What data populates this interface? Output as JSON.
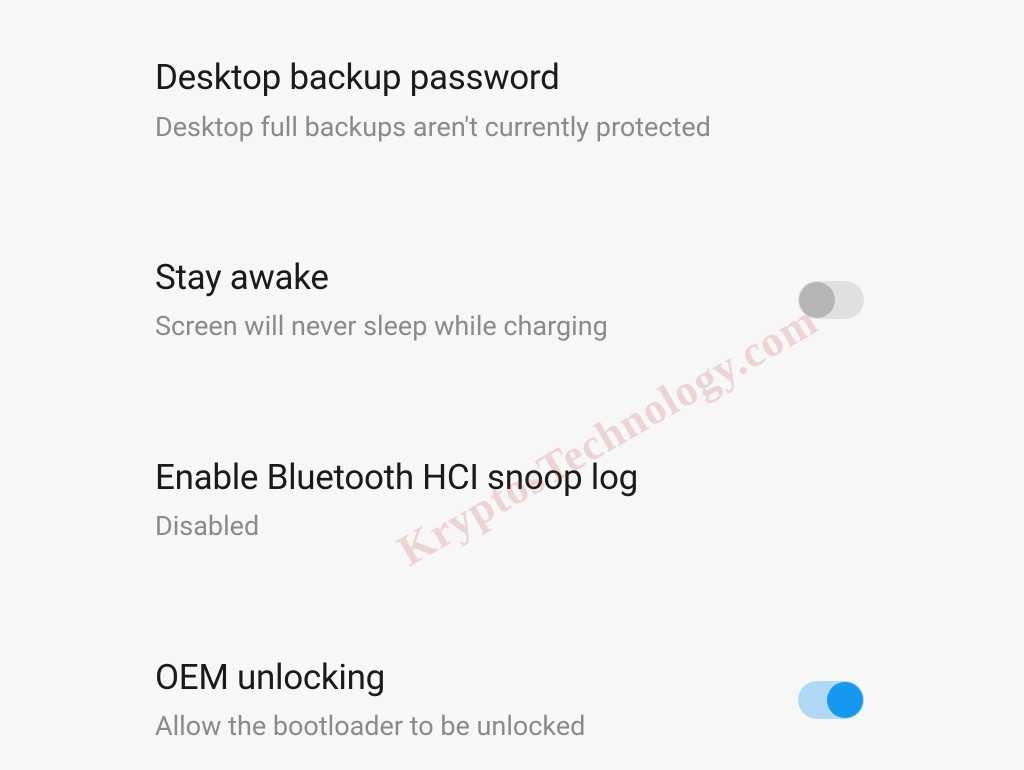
{
  "settings": {
    "items": [
      {
        "title": "Desktop backup password",
        "subtitle": "Desktop full backups aren't currently protected",
        "has_toggle": false
      },
      {
        "title": "Stay awake",
        "subtitle": "Screen will never sleep while charging",
        "has_toggle": true,
        "toggle_on": false
      },
      {
        "title": "Enable Bluetooth HCI snoop log",
        "subtitle": "Disabled",
        "has_toggle": false
      },
      {
        "title": "OEM unlocking",
        "subtitle": "Allow the bootloader to be unlocked",
        "has_toggle": true,
        "toggle_on": true
      }
    ]
  },
  "watermark": "KryptosTechnology.com"
}
